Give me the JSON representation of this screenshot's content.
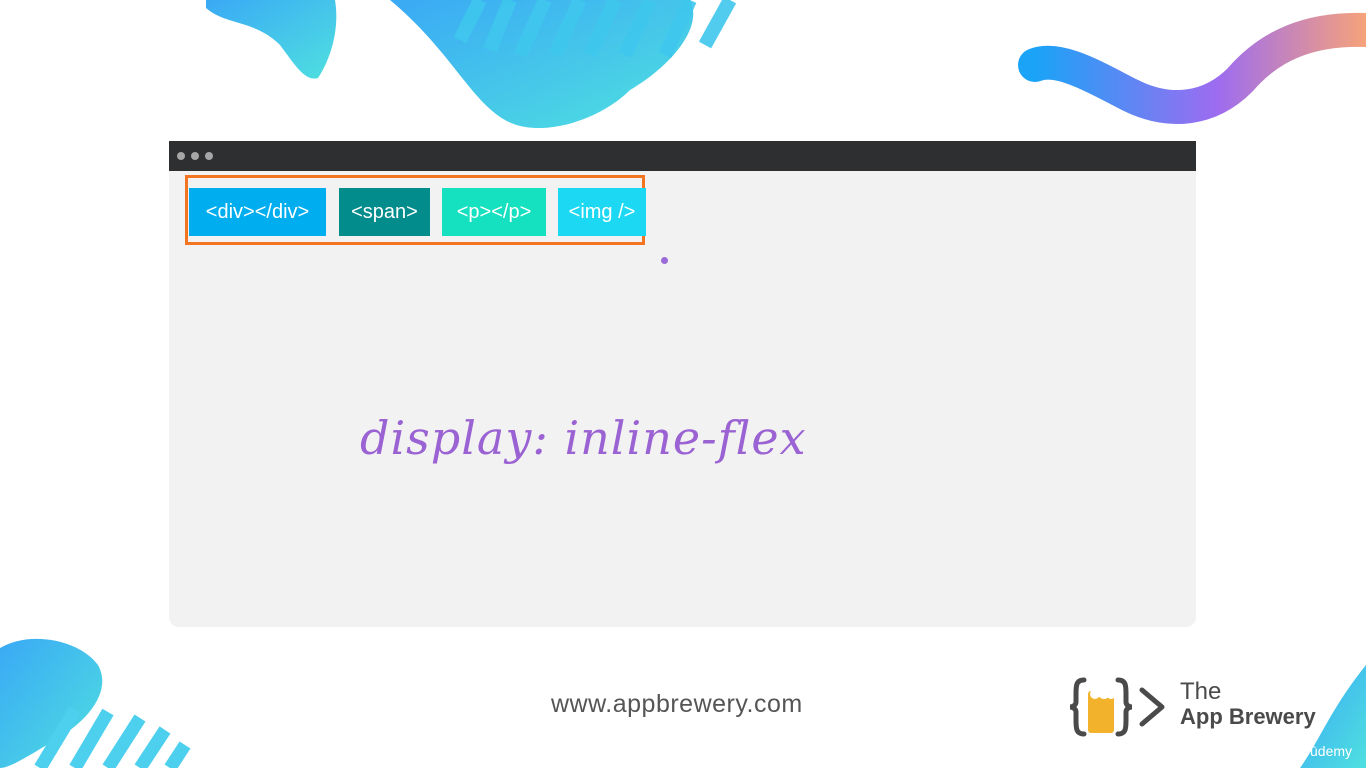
{
  "window": {
    "controls": [
      "window-dot",
      "window-dot",
      "window-dot"
    ]
  },
  "demo": {
    "tags": [
      "<div></div>",
      "<span>",
      "<p></p>",
      "<img />"
    ],
    "handwriting": "display: inline-flex"
  },
  "footer": {
    "url": "www.appbrewery.com",
    "brand_the": "The",
    "brand_name": "App Brewery",
    "platform": "ūdemy"
  },
  "colors": {
    "div": "#00aeef",
    "span": "#038c8c",
    "p": "#15e0c0",
    "img": "#1cd8f2",
    "outline": "#f37521",
    "handwriting": "#9a62d3",
    "titlebar": "#2e2f31"
  }
}
